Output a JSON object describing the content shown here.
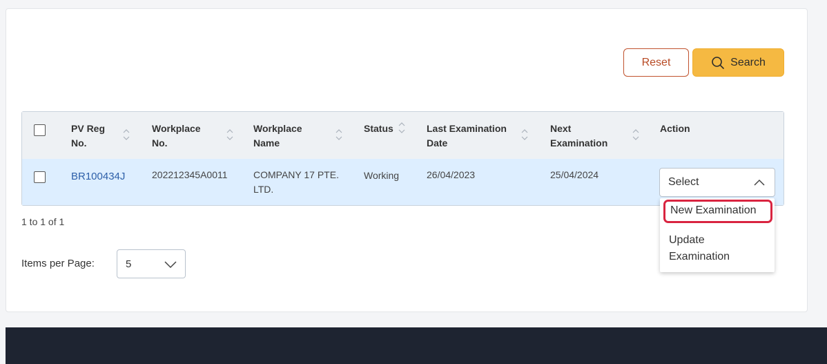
{
  "buttons": {
    "reset": "Reset",
    "search": "Search"
  },
  "table": {
    "columns": [
      {
        "l1": "PV Reg",
        "l2": "No."
      },
      {
        "l1": "Workplace",
        "l2": "No."
      },
      {
        "l1": "Workplace",
        "l2": "Name"
      },
      {
        "l1": "Status",
        "l2": ""
      },
      {
        "l1": "Last Examination",
        "l2": "Date"
      },
      {
        "l1": "Next",
        "l2": "Examination"
      },
      {
        "l1": "Action",
        "l2": ""
      }
    ],
    "rows": [
      {
        "pv_reg_no": "BR100434J",
        "workplace_no": "202212345A0011",
        "workplace_name_l1": "COMPANY 17 PTE.",
        "workplace_name_l2": "LTD.",
        "status": "Working",
        "last_exam_date": "26/04/2023",
        "next_exam": "25/04/2024",
        "action_select": "Select"
      }
    ]
  },
  "action_menu": {
    "items": [
      "New Examination",
      "Update",
      "Examination"
    ]
  },
  "pagination": {
    "summary": "1 to 1 of 1",
    "items_per_page_label": "Items per Page:",
    "items_per_page_value": "5"
  }
}
